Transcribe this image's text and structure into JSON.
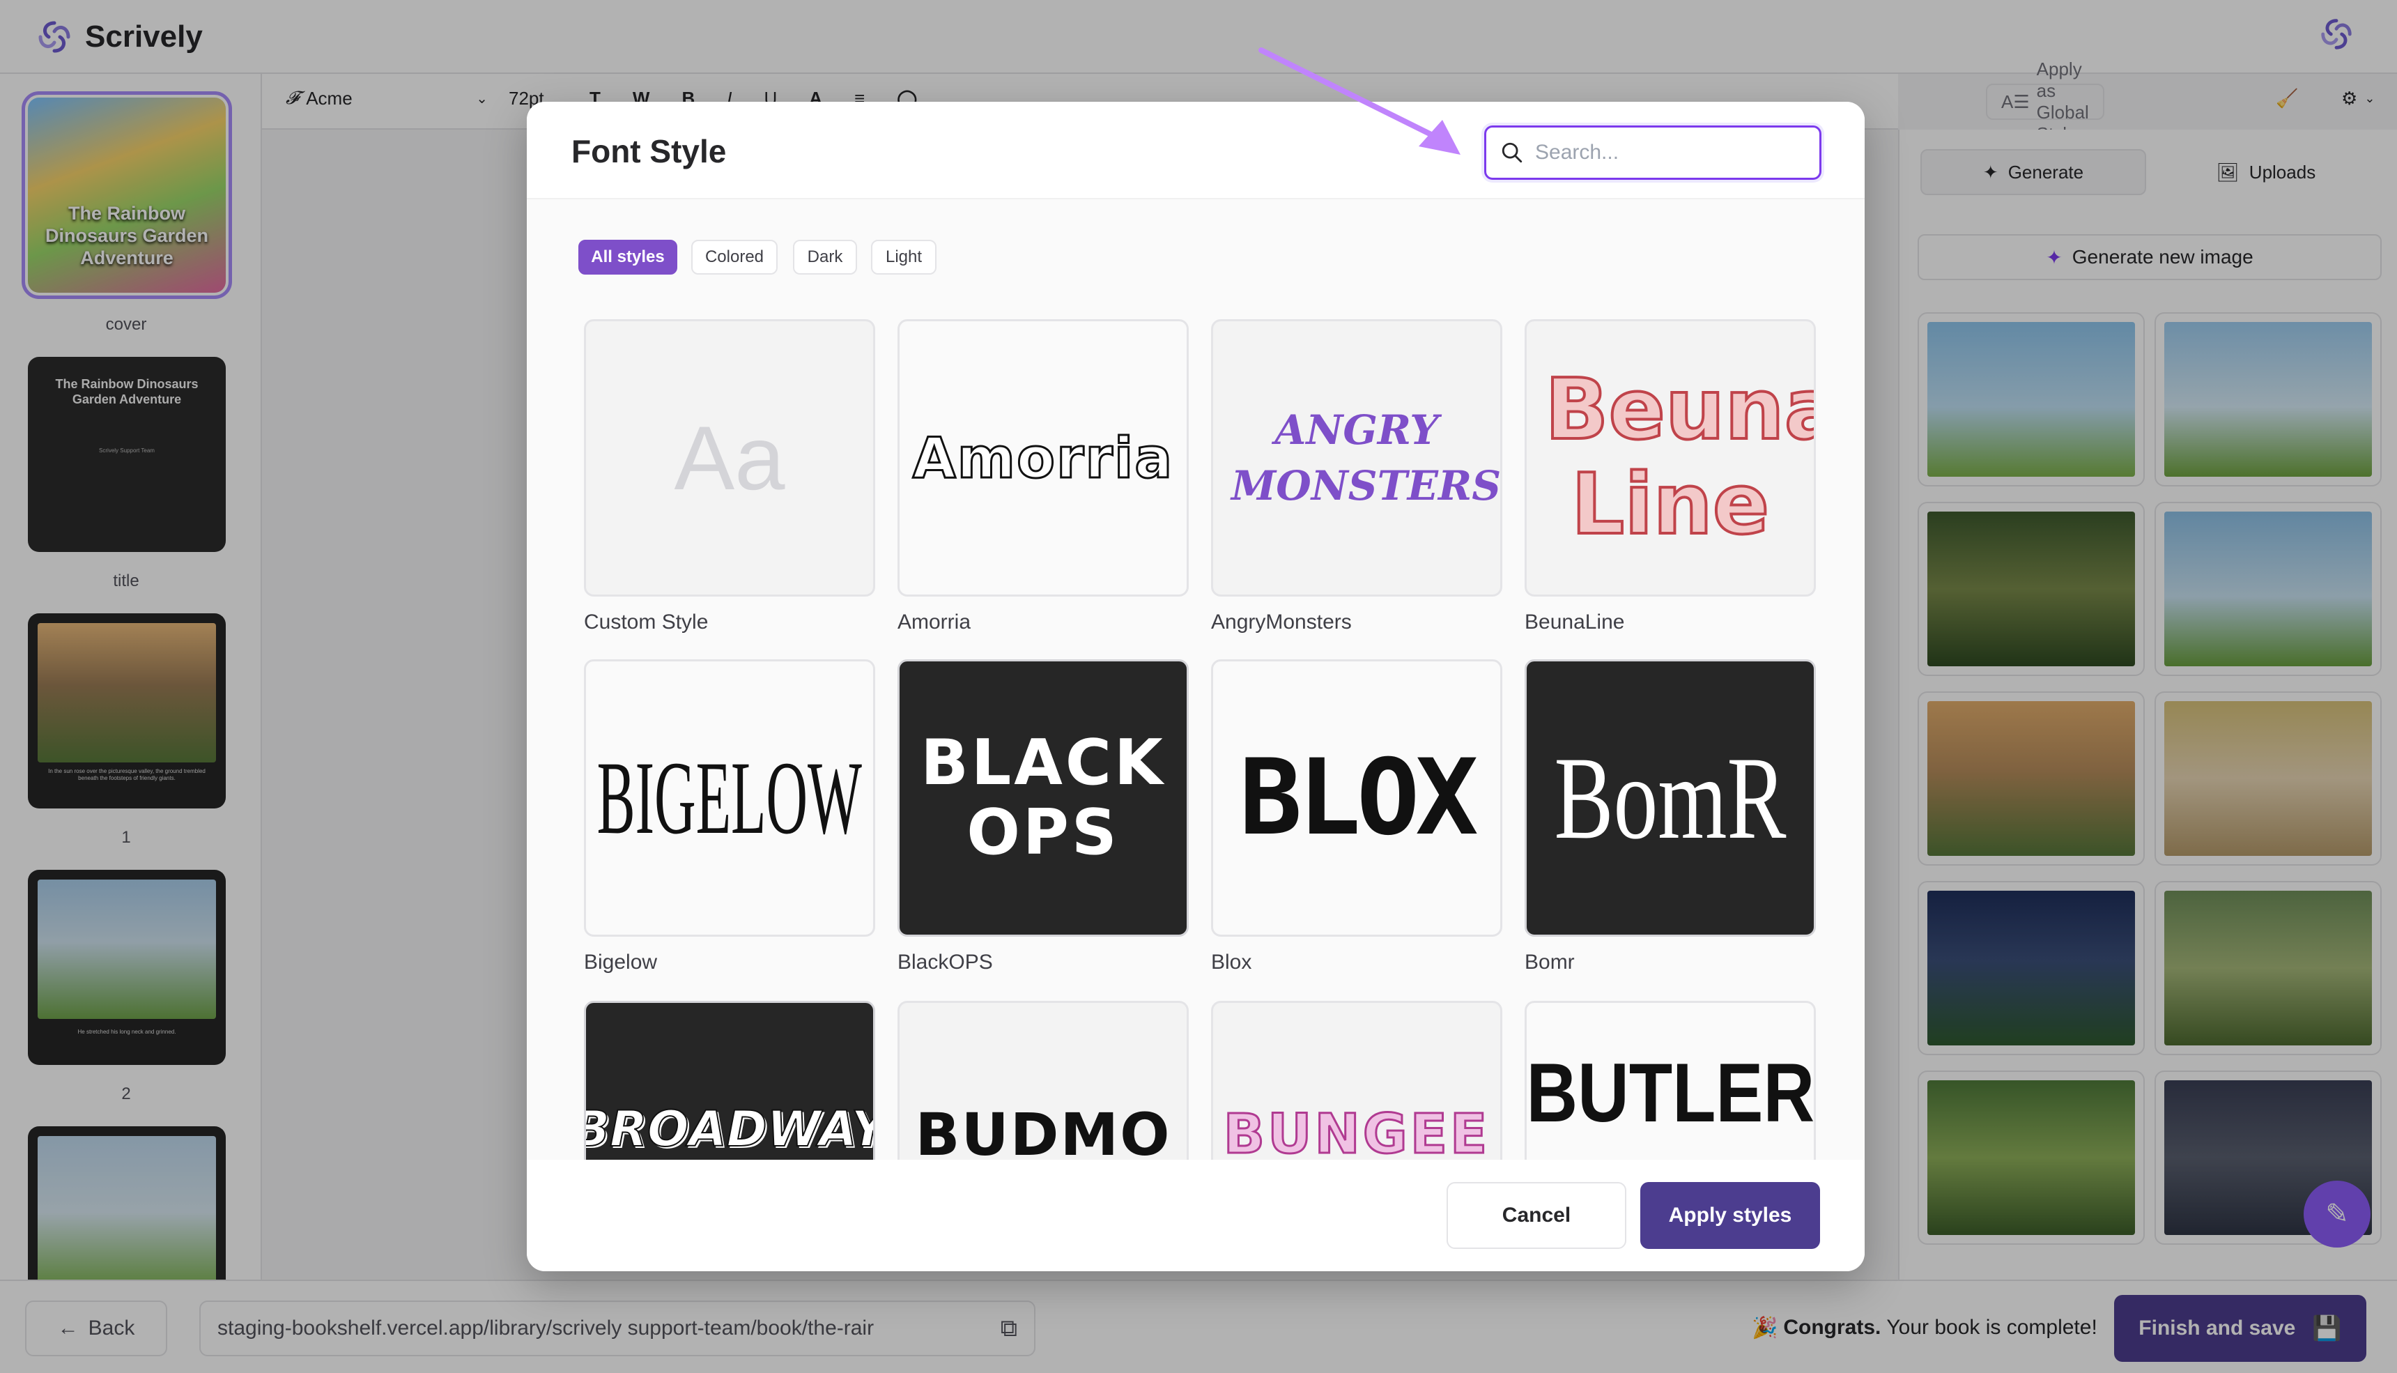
{
  "app": {
    "name": "Scrively"
  },
  "sidebar": {
    "pages": [
      {
        "label": "cover",
        "caption": "The Rainbow Dinosaurs Garden Adventure"
      },
      {
        "label": "title",
        "caption": "The Rainbow Dinosaurs Garden Adventure",
        "sub": "Scrively Support Team"
      },
      {
        "label": "1",
        "caption": "In the sun rose over the picturesque valley, the ground trembled beneath the footsteps of friendly giants."
      },
      {
        "label": "2",
        "caption": "He stretched his long neck and grinned."
      },
      {
        "label": "",
        "caption": ""
      }
    ]
  },
  "toolbar": {
    "font_name": "Acme",
    "font_size": "72pt",
    "global_style": "Apply as Global Style"
  },
  "right_panel": {
    "tabs": [
      {
        "label": "Generate"
      },
      {
        "label": "Uploads"
      }
    ],
    "generate_button": "Generate new image"
  },
  "modal": {
    "title": "Font Style",
    "search_placeholder": "Search...",
    "filters": [
      {
        "label": "All styles",
        "active": true
      },
      {
        "label": "Colored",
        "active": false
      },
      {
        "label": "Dark",
        "active": false
      },
      {
        "label": "Light",
        "active": false
      }
    ],
    "fonts": [
      {
        "name": "Custom Style",
        "preview": "Aa"
      },
      {
        "name": "Amorria",
        "preview": "Amorria"
      },
      {
        "name": "AngryMonsters",
        "preview": "ANGRY MONSTERS"
      },
      {
        "name": "BeunaLine",
        "preview": "Beuna Line"
      },
      {
        "name": "Bigelow",
        "preview": "BIGELOW"
      },
      {
        "name": "BlackOPS",
        "preview": "BLACK OPS"
      },
      {
        "name": "Blox",
        "preview": "BLOX"
      },
      {
        "name": "Bomr",
        "preview": "BomR"
      },
      {
        "name": "",
        "preview": "BROADWAY"
      },
      {
        "name": "",
        "preview": "BUDMO"
      },
      {
        "name": "",
        "preview": "BUNGEE"
      },
      {
        "name": "",
        "preview": "BUTLER"
      }
    ],
    "cancel": "Cancel",
    "apply": "Apply styles"
  },
  "bottom_bar": {
    "back": "Back",
    "url": "staging-bookshelf.vercel.app/library/scrively support-team/book/the-rair",
    "congrats_bold": "Congrats.",
    "congrats_rest": "Your book is complete!",
    "finish": "Finish and save"
  },
  "colors": {
    "accent": "#7e4fc9",
    "primary_button": "#4c3d8f",
    "arrow": "#c084fc"
  }
}
